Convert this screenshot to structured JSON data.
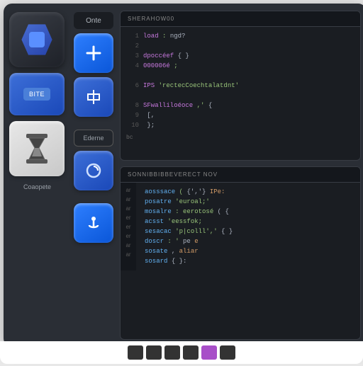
{
  "mid": {
    "top_label": "Onte",
    "outline_label": "Ederne"
  },
  "left": {
    "pill_label": "BITE",
    "caption": "Coaopete"
  },
  "panel1": {
    "title": "SHERAHOW00",
    "lines": [
      {
        "n": "1",
        "a": "load",
        "b": ":",
        "c": "ngd?"
      },
      {
        "n": "2",
        "a": "",
        "b": "<e>",
        "c": ""
      },
      {
        "n": "3",
        "a": "dpoccéef",
        "b": "",
        "c": "{ }"
      },
      {
        "n": "4",
        "a": "000006é",
        "b": ";",
        "c": ""
      },
      {
        "n": "",
        "a": "",
        "b": "",
        "c": ""
      },
      {
        "n": "6",
        "a": "IPS",
        "b": "'rectecCoechtalatdnt'",
        "c": ""
      },
      {
        "n": "",
        "a": "",
        "b": "",
        "c": ""
      },
      {
        "n": "8",
        "a": "SFwalliloéoce",
        "b": ",'",
        "c": "{"
      },
      {
        "n": "9",
        "a": "",
        "b": "",
        "c": "[,"
      },
      {
        "n": "10",
        "a": "",
        "b": "",
        "c": "};"
      }
    ],
    "foot": "bc"
  },
  "panel2": {
    "title": "SONNIBBIBBEVERECT NOV",
    "gutter": [
      "ar",
      "ar",
      "ar",
      "er",
      "er",
      "er",
      "ar",
      "ar"
    ],
    "lines": [
      {
        "a": "aosssace",
        "b": "(",
        "c": "{','}",
        "d": "IPe:"
      },
      {
        "a": "posatre",
        "b": "'euroal;'",
        "c": "",
        "d": ""
      },
      {
        "a": "mosalre",
        "b": ": eerotosé",
        "c": "( {",
        "d": ""
      },
      {
        "a": "acsst",
        "b": "'eessfok;",
        "c": "",
        "d": ""
      },
      {
        "a": "sesacac",
        "b": "'p|colll','",
        "c": "{ }",
        "d": ""
      },
      {
        "a": "doscr",
        "b": ": '",
        "c": "pe",
        "d": "e"
      },
      {
        "a": "sosate",
        "b": "",
        "c": ",",
        "d": "aliar"
      },
      {
        "a": "sosard",
        "b": "",
        "c": "{ }:",
        "d": ""
      }
    ]
  }
}
